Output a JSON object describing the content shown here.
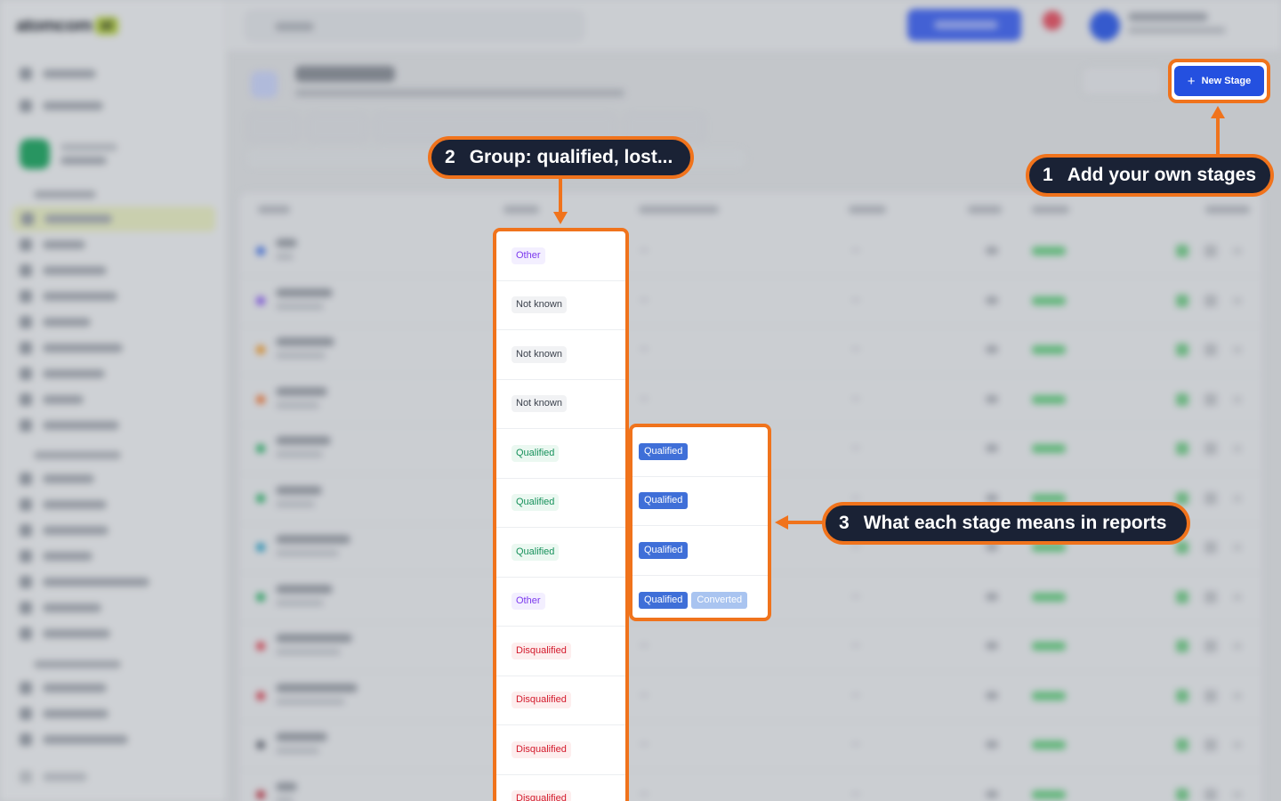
{
  "app": {
    "logo_text": "atomcom",
    "logo_badge": "ai"
  },
  "header": {
    "new_stage_button": "New Stage"
  },
  "stage_type_column": [
    {
      "label": "Other",
      "kind": "other"
    },
    {
      "label": "Not known",
      "kind": "notknown"
    },
    {
      "label": "Not known",
      "kind": "notknown"
    },
    {
      "label": "Not known",
      "kind": "notknown"
    },
    {
      "label": "Qualified",
      "kind": "qualified"
    },
    {
      "label": "Qualified",
      "kind": "qualified"
    },
    {
      "label": "Qualified",
      "kind": "qualified"
    },
    {
      "label": "Other",
      "kind": "other"
    },
    {
      "label": "Disqualified",
      "kind": "disqualified"
    },
    {
      "label": "Disqualified",
      "kind": "disqualified"
    },
    {
      "label": "Disqualified",
      "kind": "disqualified"
    },
    {
      "label": "Disqualified",
      "kind": "disqualified"
    }
  ],
  "report_meaning_column": [
    {
      "tags": [
        "Qualified"
      ]
    },
    {
      "tags": [
        "Qualified"
      ]
    },
    {
      "tags": [
        "Qualified"
      ]
    },
    {
      "tags": [
        "Qualified",
        "Converted"
      ]
    }
  ],
  "callouts": {
    "c1": {
      "num": "1",
      "text": "Add your own stages"
    },
    "c2": {
      "num": "2",
      "text": "Group: qualified, lost..."
    },
    "c3": {
      "num": "3",
      "text": "What each stage means in reports"
    }
  },
  "colors": {
    "highlight": "#f0731c",
    "callout_bg": "#1a2235",
    "primary_button": "#2450e0",
    "other": "#7c3aed",
    "qualified": "#17915b",
    "disqualified": "#d3192b",
    "report_tag": "#3f6fd8"
  }
}
